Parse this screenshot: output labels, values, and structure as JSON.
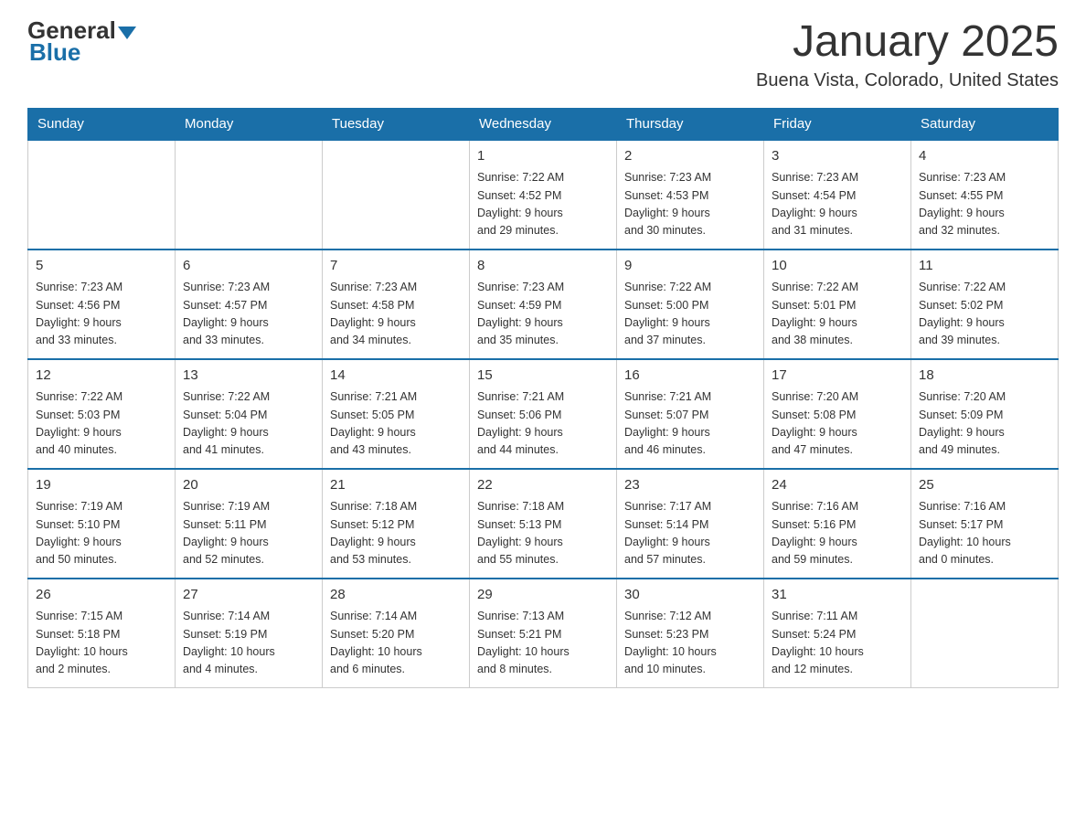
{
  "logo": {
    "general": "General",
    "blue": "Blue"
  },
  "header": {
    "title": "January 2025",
    "location": "Buena Vista, Colorado, United States"
  },
  "days_of_week": [
    "Sunday",
    "Monday",
    "Tuesday",
    "Wednesday",
    "Thursday",
    "Friday",
    "Saturday"
  ],
  "weeks": [
    {
      "days": [
        {
          "num": "",
          "info": ""
        },
        {
          "num": "",
          "info": ""
        },
        {
          "num": "",
          "info": ""
        },
        {
          "num": "1",
          "info": "Sunrise: 7:22 AM\nSunset: 4:52 PM\nDaylight: 9 hours\nand 29 minutes."
        },
        {
          "num": "2",
          "info": "Sunrise: 7:23 AM\nSunset: 4:53 PM\nDaylight: 9 hours\nand 30 minutes."
        },
        {
          "num": "3",
          "info": "Sunrise: 7:23 AM\nSunset: 4:54 PM\nDaylight: 9 hours\nand 31 minutes."
        },
        {
          "num": "4",
          "info": "Sunrise: 7:23 AM\nSunset: 4:55 PM\nDaylight: 9 hours\nand 32 minutes."
        }
      ]
    },
    {
      "days": [
        {
          "num": "5",
          "info": "Sunrise: 7:23 AM\nSunset: 4:56 PM\nDaylight: 9 hours\nand 33 minutes."
        },
        {
          "num": "6",
          "info": "Sunrise: 7:23 AM\nSunset: 4:57 PM\nDaylight: 9 hours\nand 33 minutes."
        },
        {
          "num": "7",
          "info": "Sunrise: 7:23 AM\nSunset: 4:58 PM\nDaylight: 9 hours\nand 34 minutes."
        },
        {
          "num": "8",
          "info": "Sunrise: 7:23 AM\nSunset: 4:59 PM\nDaylight: 9 hours\nand 35 minutes."
        },
        {
          "num": "9",
          "info": "Sunrise: 7:22 AM\nSunset: 5:00 PM\nDaylight: 9 hours\nand 37 minutes."
        },
        {
          "num": "10",
          "info": "Sunrise: 7:22 AM\nSunset: 5:01 PM\nDaylight: 9 hours\nand 38 minutes."
        },
        {
          "num": "11",
          "info": "Sunrise: 7:22 AM\nSunset: 5:02 PM\nDaylight: 9 hours\nand 39 minutes."
        }
      ]
    },
    {
      "days": [
        {
          "num": "12",
          "info": "Sunrise: 7:22 AM\nSunset: 5:03 PM\nDaylight: 9 hours\nand 40 minutes."
        },
        {
          "num": "13",
          "info": "Sunrise: 7:22 AM\nSunset: 5:04 PM\nDaylight: 9 hours\nand 41 minutes."
        },
        {
          "num": "14",
          "info": "Sunrise: 7:21 AM\nSunset: 5:05 PM\nDaylight: 9 hours\nand 43 minutes."
        },
        {
          "num": "15",
          "info": "Sunrise: 7:21 AM\nSunset: 5:06 PM\nDaylight: 9 hours\nand 44 minutes."
        },
        {
          "num": "16",
          "info": "Sunrise: 7:21 AM\nSunset: 5:07 PM\nDaylight: 9 hours\nand 46 minutes."
        },
        {
          "num": "17",
          "info": "Sunrise: 7:20 AM\nSunset: 5:08 PM\nDaylight: 9 hours\nand 47 minutes."
        },
        {
          "num": "18",
          "info": "Sunrise: 7:20 AM\nSunset: 5:09 PM\nDaylight: 9 hours\nand 49 minutes."
        }
      ]
    },
    {
      "days": [
        {
          "num": "19",
          "info": "Sunrise: 7:19 AM\nSunset: 5:10 PM\nDaylight: 9 hours\nand 50 minutes."
        },
        {
          "num": "20",
          "info": "Sunrise: 7:19 AM\nSunset: 5:11 PM\nDaylight: 9 hours\nand 52 minutes."
        },
        {
          "num": "21",
          "info": "Sunrise: 7:18 AM\nSunset: 5:12 PM\nDaylight: 9 hours\nand 53 minutes."
        },
        {
          "num": "22",
          "info": "Sunrise: 7:18 AM\nSunset: 5:13 PM\nDaylight: 9 hours\nand 55 minutes."
        },
        {
          "num": "23",
          "info": "Sunrise: 7:17 AM\nSunset: 5:14 PM\nDaylight: 9 hours\nand 57 minutes."
        },
        {
          "num": "24",
          "info": "Sunrise: 7:16 AM\nSunset: 5:16 PM\nDaylight: 9 hours\nand 59 minutes."
        },
        {
          "num": "25",
          "info": "Sunrise: 7:16 AM\nSunset: 5:17 PM\nDaylight: 10 hours\nand 0 minutes."
        }
      ]
    },
    {
      "days": [
        {
          "num": "26",
          "info": "Sunrise: 7:15 AM\nSunset: 5:18 PM\nDaylight: 10 hours\nand 2 minutes."
        },
        {
          "num": "27",
          "info": "Sunrise: 7:14 AM\nSunset: 5:19 PM\nDaylight: 10 hours\nand 4 minutes."
        },
        {
          "num": "28",
          "info": "Sunrise: 7:14 AM\nSunset: 5:20 PM\nDaylight: 10 hours\nand 6 minutes."
        },
        {
          "num": "29",
          "info": "Sunrise: 7:13 AM\nSunset: 5:21 PM\nDaylight: 10 hours\nand 8 minutes."
        },
        {
          "num": "30",
          "info": "Sunrise: 7:12 AM\nSunset: 5:23 PM\nDaylight: 10 hours\nand 10 minutes."
        },
        {
          "num": "31",
          "info": "Sunrise: 7:11 AM\nSunset: 5:24 PM\nDaylight: 10 hours\nand 12 minutes."
        },
        {
          "num": "",
          "info": ""
        }
      ]
    }
  ]
}
